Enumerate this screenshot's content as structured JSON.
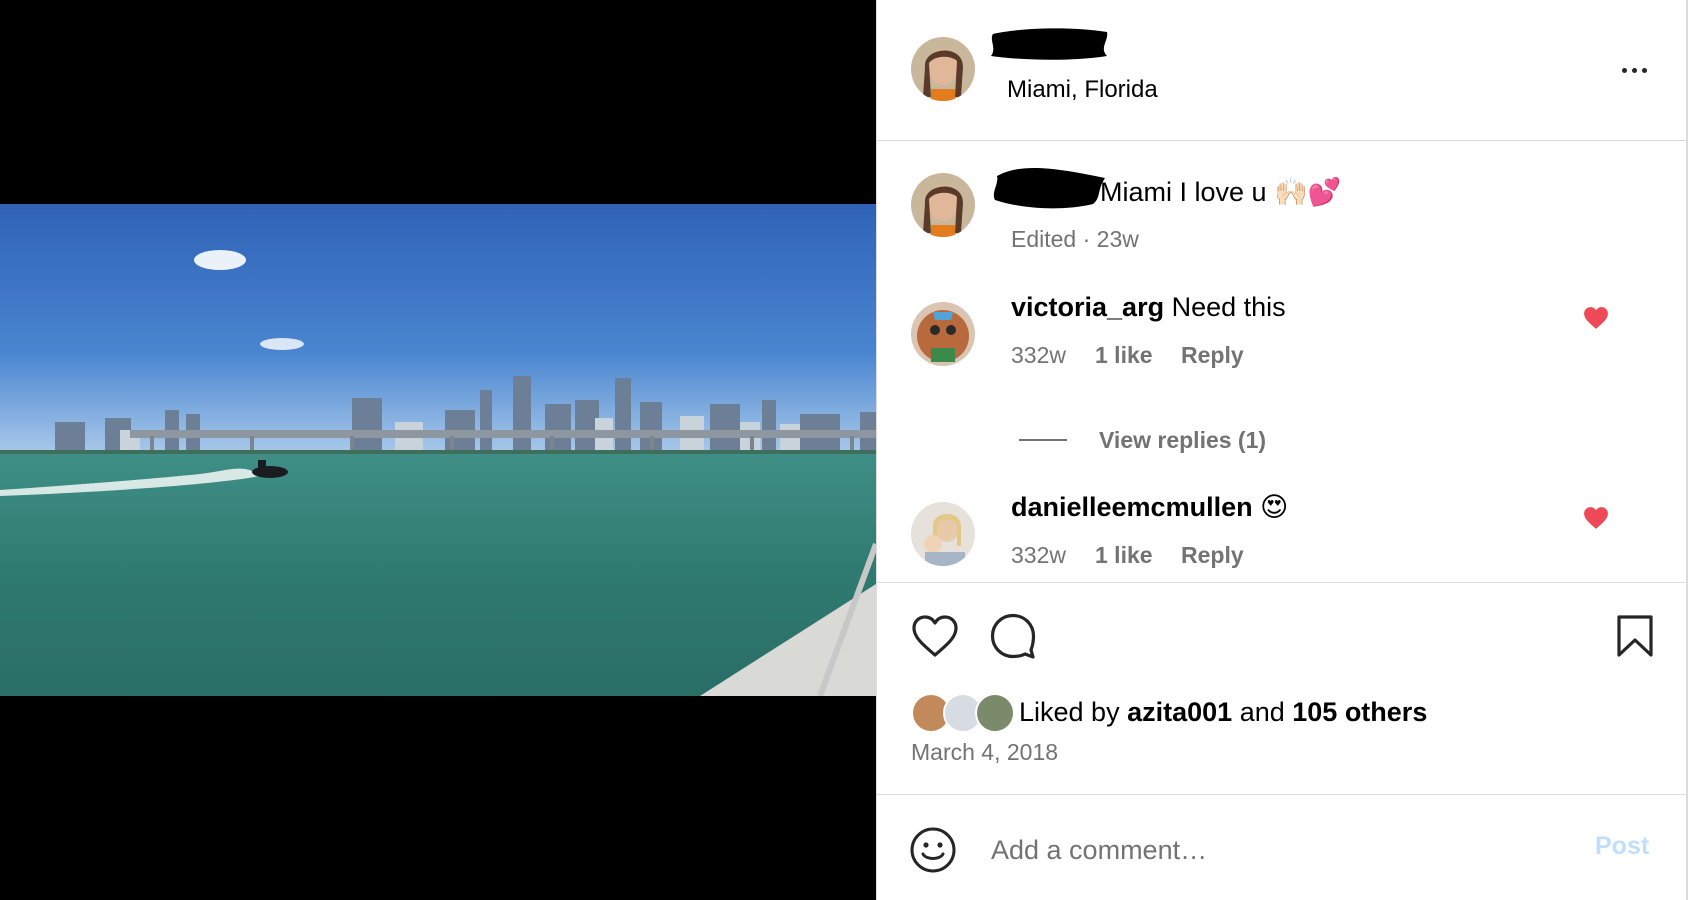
{
  "post": {
    "location": "Miami, Florida",
    "caption": "Miami I love u 🙌🏻💕",
    "caption_meta": "Edited · 23w"
  },
  "comments": [
    {
      "username": "victoria_arg",
      "text": "Need this",
      "age": "332w",
      "likes": "1 like",
      "reply_label": "Reply",
      "liked": true
    },
    {
      "username": "danielleemcmullen",
      "text": "😍",
      "age": "332w",
      "likes": "1 like",
      "reply_label": "Reply",
      "liked": true
    }
  ],
  "view_replies": "View replies (1)",
  "likes": {
    "prefix": "Liked by",
    "user": "azita001",
    "joiner": "and",
    "others": "105 others"
  },
  "date": "March 4, 2018",
  "composer": {
    "placeholder": "Add a comment…",
    "post_label": "Post"
  },
  "icons": {
    "more": "more-horizontal-icon",
    "like": "heart-outline-icon",
    "comment": "comment-bubble-icon",
    "save": "bookmark-icon",
    "emoji": "smiley-icon",
    "comment_like": "heart-filled-icon"
  },
  "colors": {
    "heart": "#ed4956",
    "muted": "#737373",
    "post_disabled": "#c0dffd"
  }
}
